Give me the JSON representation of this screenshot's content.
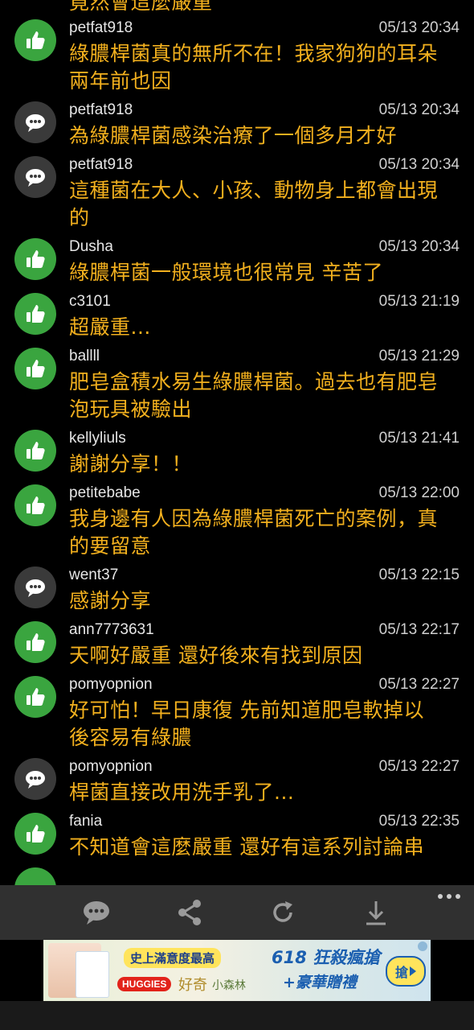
{
  "top_partial_text": "竟然會這麼嚴重",
  "comments": [
    {
      "type": "push",
      "user": "petfat918",
      "time": "05/13 20:34",
      "lines": [
        "綠膿桿菌真的無所不在！我家狗狗的耳朵",
        "兩年前也因"
      ]
    },
    {
      "type": "neutral",
      "user": "petfat918",
      "time": "05/13 20:34",
      "lines": [
        "為綠膿桿菌感染治療了一個多月才好"
      ]
    },
    {
      "type": "neutral",
      "user": "petfat918",
      "time": "05/13 20:34",
      "lines": [
        "這種菌在大人、小孩、動物身上都會出現",
        "的"
      ]
    },
    {
      "type": "push",
      "user": "Dusha",
      "time": "05/13 20:34",
      "lines": [
        "綠膿桿菌一般環境也很常見 辛苦了"
      ]
    },
    {
      "type": "push",
      "user": "c3101",
      "time": "05/13 21:19",
      "lines": [
        "超嚴重..."
      ]
    },
    {
      "type": "push",
      "user": "ballll",
      "time": "05/13 21:29",
      "lines": [
        "肥皂盒積水易生綠膿桿菌。過去也有肥皂",
        "泡玩具被驗出"
      ]
    },
    {
      "type": "push",
      "user": "kellyliuls",
      "time": "05/13 21:41",
      "lines": [
        "謝謝分享！！"
      ]
    },
    {
      "type": "push",
      "user": "petitebabe",
      "time": "05/13 22:00",
      "lines": [
        "我身邊有人因為綠膿桿菌死亡的案例，真",
        "的要留意"
      ]
    },
    {
      "type": "neutral",
      "user": "went37",
      "time": "05/13 22:15",
      "lines": [
        "感謝分享"
      ]
    },
    {
      "type": "push",
      "user": "ann7773631",
      "time": "05/13 22:17",
      "lines": [
        "天啊好嚴重 還好後來有找到原因"
      ]
    },
    {
      "type": "push",
      "user": "pomyopnion",
      "time": "05/13 22:27",
      "lines": [
        "好可怕！早日康復 先前知道肥皂軟掉以",
        "後容易有綠膿"
      ]
    },
    {
      "type": "neutral",
      "user": "pomyopnion",
      "time": "05/13 22:27",
      "lines": [
        "桿菌直接改用洗手乳了..."
      ]
    },
    {
      "type": "push",
      "user": "fania",
      "time": "05/13 22:35",
      "lines": [
        "不知道會這麼嚴重 還好有這系列討論串"
      ]
    }
  ],
  "toolbar": {
    "icons": [
      "comment-icon",
      "share-icon",
      "refresh-icon",
      "download-icon",
      "more-icon"
    ]
  },
  "ad": {
    "brand": "HUGGIES",
    "brand_cn": "好奇",
    "product": "小森林",
    "headline": "史上滿意度最高",
    "promo_line1": "618 狂殺瘋搶",
    "promo_line2": "+豪華贈禮",
    "cta": "搶"
  },
  "colors": {
    "push_green": "#3aa53f",
    "neutral_gray": "#3a3a3a",
    "comment_text": "#f2b01e",
    "toolbar_bg": "#303030"
  }
}
